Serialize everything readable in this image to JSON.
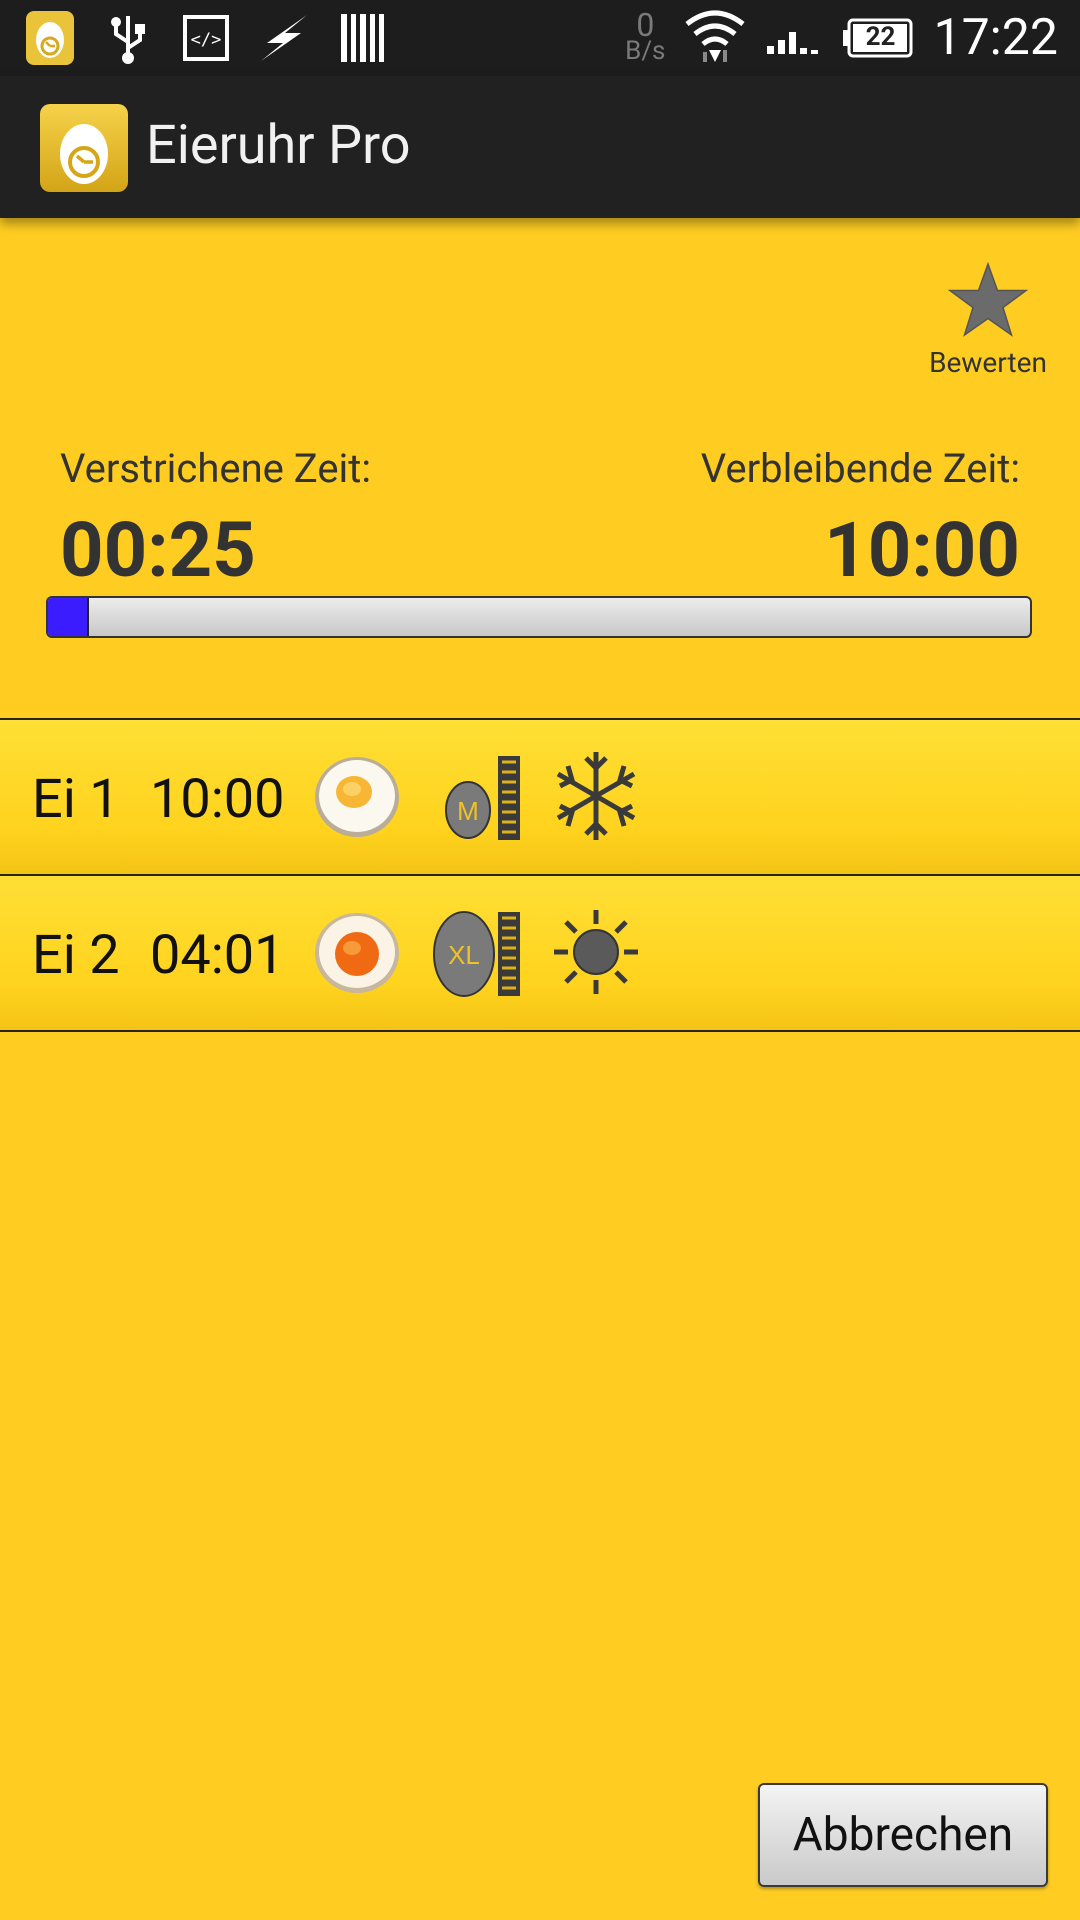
{
  "status_bar": {
    "speed_value": "0",
    "speed_unit": "B/s",
    "battery": "22",
    "time": "17:22"
  },
  "app_bar": {
    "title": "Eieruhr Pro"
  },
  "rate": {
    "label": "Bewerten"
  },
  "timer": {
    "elapsed_label": "Verstrichene Zeit:",
    "elapsed_value": "00:25",
    "remaining_label": "Verbleibende Zeit:",
    "remaining_value": "10:00",
    "progress_fraction": 0.04
  },
  "eggs": [
    {
      "name": "Ei 1",
      "time": "10:00",
      "size": "M",
      "temperature": "snowflake-icon"
    },
    {
      "name": "Ei 2",
      "time": "04:01",
      "size": "XL",
      "temperature": "sun-icon"
    }
  ],
  "actions": {
    "cancel_label": "Abbrechen"
  },
  "colors": {
    "background": "#ffcd22",
    "progress_fill": "#3a1cff",
    "bar_dark": "#1d1d1d"
  }
}
